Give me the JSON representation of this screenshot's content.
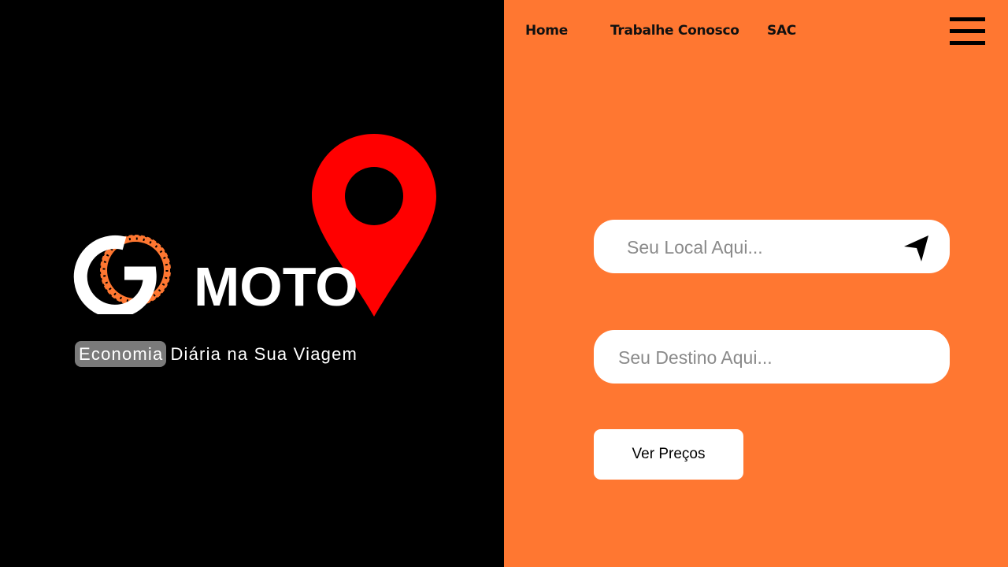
{
  "brand": {
    "word": "MOTO",
    "logo_icon": "go-tire-logo-icon",
    "pin_icon": "location-pin-icon",
    "tagline_highlight": "Economia",
    "tagline_rest": "Diária na Sua Viagem"
  },
  "nav": {
    "items": [
      {
        "label": "Home"
      },
      {
        "label": "Trabalhe Conosco"
      },
      {
        "label": "SAC"
      }
    ],
    "menu_icon": "hamburger-menu-icon"
  },
  "form": {
    "origin_placeholder": "Seu Local Aqui...",
    "origin_value": "",
    "locate_icon": "navigation-arrow-icon",
    "destination_placeholder": "Seu Destino Aqui...",
    "destination_value": "",
    "submit_label": "Ver Preços"
  },
  "colors": {
    "left_background": "#000000",
    "right_background": "#FF7731",
    "pin": "#FF0000",
    "accent": "#FF7731"
  }
}
